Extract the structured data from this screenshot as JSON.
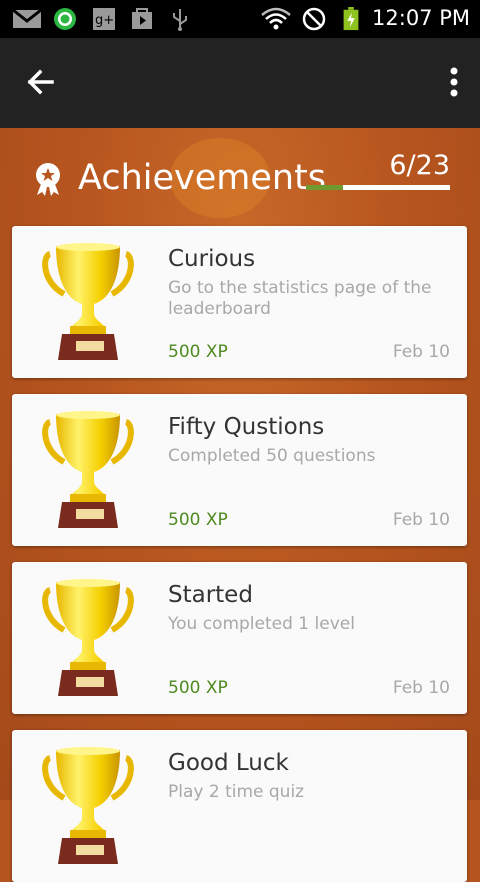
{
  "status_bar": {
    "time": "12:07 PM",
    "icons": [
      "gmail-icon",
      "whatsapp-icon",
      "google-plus-icon",
      "play-store-icon",
      "usb-icon",
      "wifi-icon",
      "do-not-disturb-icon",
      "battery-charging-icon"
    ]
  },
  "action_bar": {
    "back_icon": "arrow-left-icon",
    "menu_icon": "overflow-menu-icon"
  },
  "header": {
    "title": "Achievements",
    "count": "6/23",
    "progress": 0.26,
    "accent": "#6e9a2e"
  },
  "achievements": [
    {
      "title": "Curious",
      "description": "Go to the statistics page of the leaderboard",
      "xp": "500 XP",
      "date": "Feb 10"
    },
    {
      "title": "Fifty Qustions",
      "description": "Completed 50 questions",
      "xp": "500 XP",
      "date": "Feb 10"
    },
    {
      "title": "Started",
      "description": "You completed 1 level",
      "xp": "500 XP",
      "date": "Feb 10"
    },
    {
      "title": "Good Luck",
      "description": "Play 2 time quiz",
      "xp": "",
      "date": ""
    }
  ]
}
